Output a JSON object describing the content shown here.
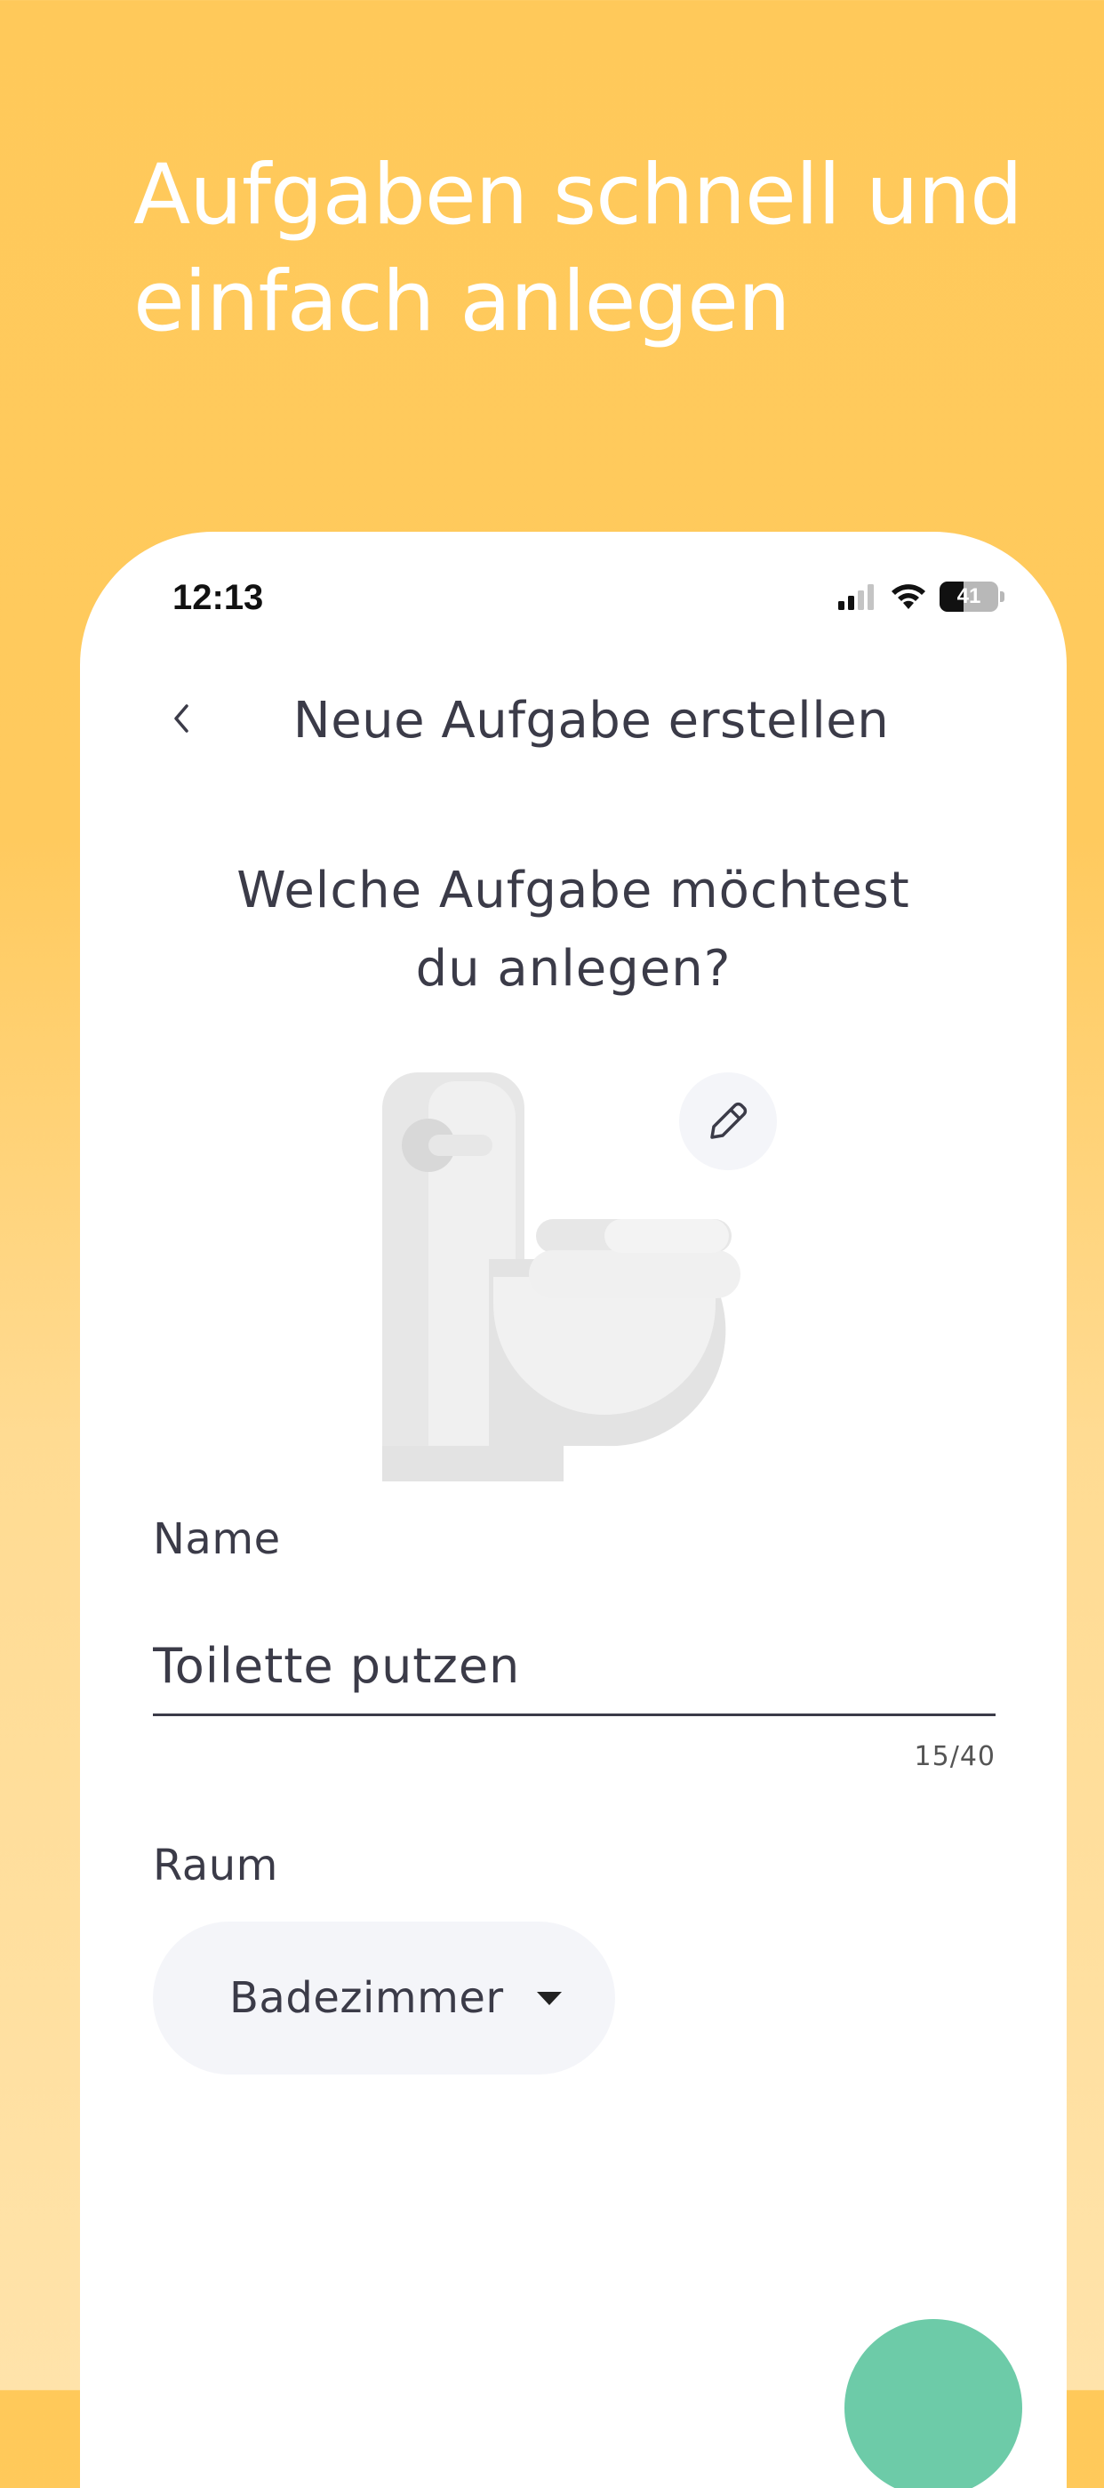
{
  "promo": {
    "headline_line1": "Aufgaben schnell und",
    "headline_line2": "einfach anlegen",
    "background_color": "#FFC95A"
  },
  "status_bar": {
    "time": "12:13",
    "battery_percent": "41",
    "battery_level": 0.41,
    "icons": [
      "cellular-signal-icon",
      "wifi-icon",
      "battery-icon"
    ]
  },
  "nav": {
    "back_icon": "chevron-left-icon",
    "title": "Neue Aufgabe erstellen"
  },
  "form": {
    "question_line1": "Welche Aufgabe möchtest",
    "question_line2": "du anlegen?",
    "task_icon": "toilet-icon",
    "edit_icon": "pencil-icon",
    "name_label": "Name",
    "name_value": "Toilette putzen",
    "name_counter": "15/40",
    "room_label": "Raum",
    "room_value": "Badezimmer",
    "room_dropdown_icon": "chevron-down-icon"
  },
  "fab": {
    "color": "#6DCBA8"
  }
}
